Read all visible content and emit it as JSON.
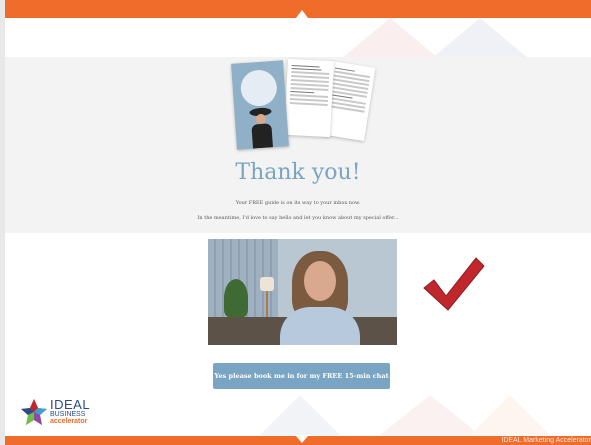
{
  "colors": {
    "accent_orange": "#ef6c2b",
    "title_blue": "#7aa4c0",
    "button_blue": "#7aa4c4",
    "hero_bg": "#f3f3f3",
    "check_red": "#c0272d"
  },
  "hero": {
    "title": "Thank you!",
    "line1": "Your FREE guide is on its way to your inbox now.",
    "line2": "In the meantime, I'd love to say hello and let you know about my special offer..."
  },
  "cta": {
    "label": "Yes please book me in for my FREE 15-min chat"
  },
  "logo": {
    "word1": "IDEAL",
    "word2": "BUSINESS",
    "word3": "accelerator"
  },
  "footer": {
    "text": "IDEAL Marketing Accelerator"
  },
  "icons": {
    "check": "checkmark-icon",
    "guide": "guide-cover-image",
    "video": "video-thumbnail"
  }
}
